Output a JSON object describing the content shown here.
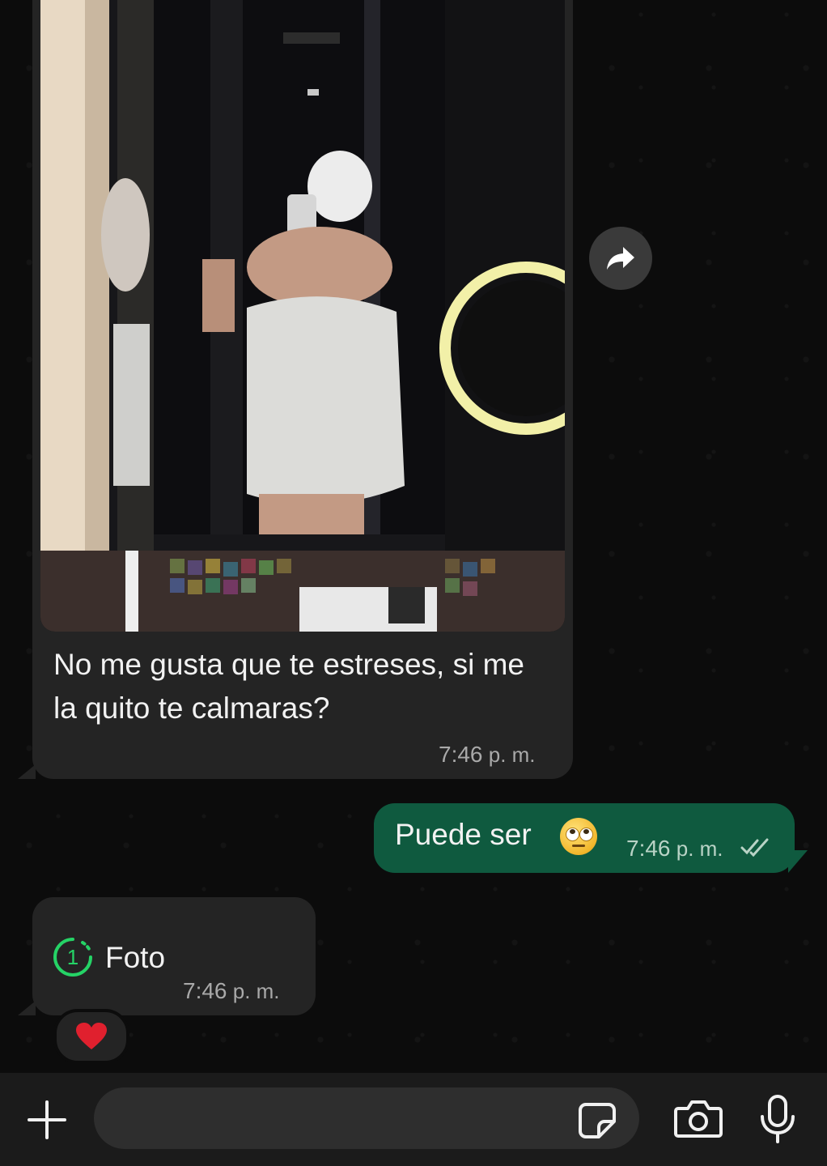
{
  "messages": {
    "incoming_photo": {
      "caption": "No me gusta que te estreses, si me la quito te calmaras?",
      "time_num": "7:46",
      "time_suffix": "p. m."
    },
    "outgoing": {
      "text": "Puede ser",
      "emoji": "rolling-eyes-emoji",
      "time_num": "7:46",
      "time_suffix": "p. m.",
      "status": "read-double-check"
    },
    "incoming_view_once": {
      "label": "Foto",
      "badge": "1",
      "time_num": "7:46",
      "time_suffix": "p. m.",
      "reaction": "❤️"
    }
  },
  "composer": {
    "input_value": "",
    "icons": [
      "plus-icon",
      "sticker-icon",
      "camera-icon",
      "microphone-icon"
    ]
  },
  "colors": {
    "incoming_bubble": "#242424",
    "outgoing_bubble": "#0f5a3f",
    "accent_green": "#25d366"
  }
}
